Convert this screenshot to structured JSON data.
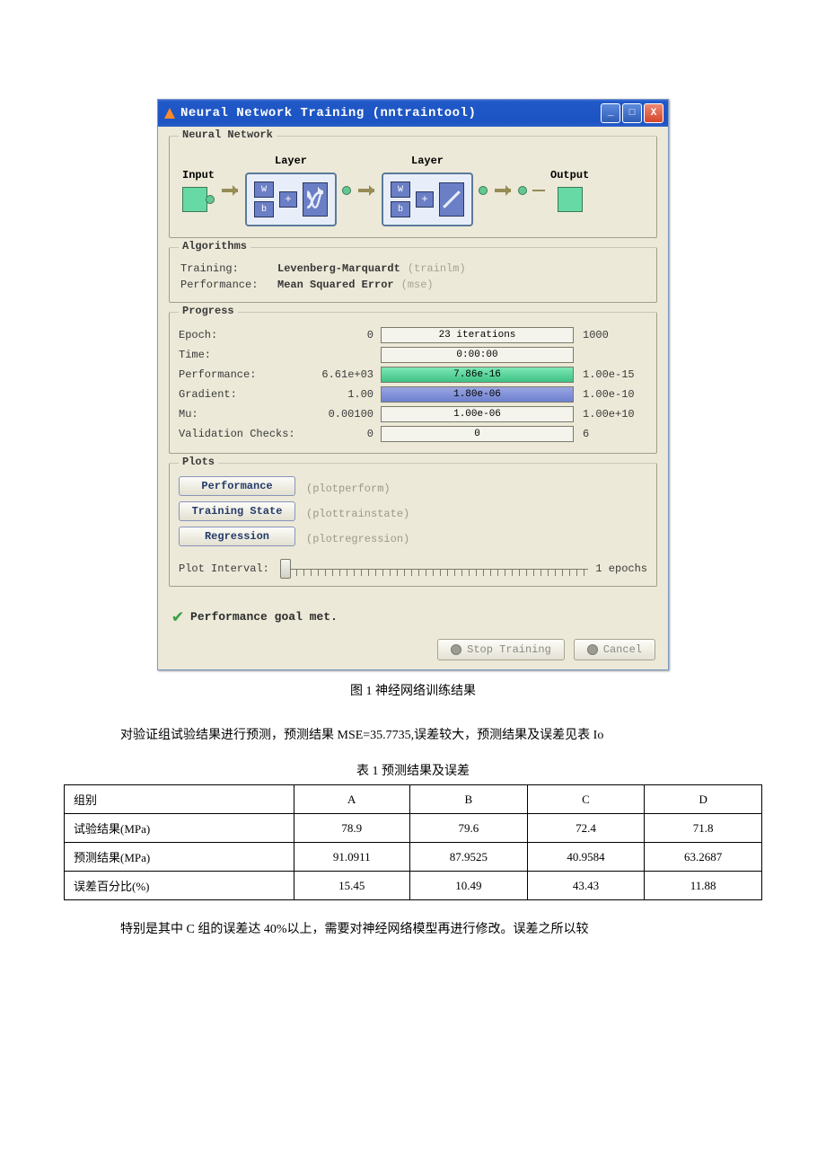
{
  "window": {
    "title": "Neural Network Training (nntraintool)",
    "icons": {
      "min": "_",
      "max": "□",
      "close": "X"
    }
  },
  "groups": {
    "network": "Neural Network",
    "algorithms": "Algorithms",
    "progress": "Progress",
    "plots": "Plots"
  },
  "diagram": {
    "input": "Input",
    "layer": "Layer",
    "output": "Output",
    "w": "W",
    "b": "b"
  },
  "algorithms": {
    "training_label": "Training:",
    "training_value": "Levenberg-Marquardt",
    "training_fn": "(trainlm)",
    "perf_label": "Performance:",
    "perf_value": "Mean Squared Error",
    "perf_fn": "(mse)"
  },
  "progress": {
    "rows": [
      {
        "label": "Epoch:",
        "start": "0",
        "text": "23 iterations",
        "end": "1000",
        "fill": "none",
        "pct": 5
      },
      {
        "label": "Time:",
        "start": "",
        "text": "0:00:00",
        "end": "",
        "fill": "none",
        "pct": 0
      },
      {
        "label": "Performance:",
        "start": "6.61e+03",
        "text": "7.86e-16",
        "end": "1.00e-15",
        "fill": "green",
        "pct": 100
      },
      {
        "label": "Gradient:",
        "start": "1.00",
        "text": "1.80e-06",
        "end": "1.00e-10",
        "fill": "blue",
        "pct": 100
      },
      {
        "label": "Mu:",
        "start": "0.00100",
        "text": "1.00e-06",
        "end": "1.00e+10",
        "fill": "none",
        "pct": 0
      },
      {
        "label": "Validation Checks:",
        "start": "0",
        "text": "0",
        "end": "6",
        "fill": "none",
        "pct": 0
      }
    ]
  },
  "plots": {
    "buttons": [
      {
        "label": "Performance",
        "fn": "(plotperform)"
      },
      {
        "label": "Training State",
        "fn": "(plottrainstate)"
      },
      {
        "label": "Regression",
        "fn": "(plotregression)"
      }
    ],
    "interval_label": "Plot Interval:",
    "interval_value": "1 epochs"
  },
  "status": "Performance goal met.",
  "footer": {
    "stop": "Stop Training",
    "cancel": "Cancel"
  },
  "doc": {
    "fig_caption": "图 1 神经网络训练结果",
    "para1": "对验证组试验结果进行预测，预测结果 MSE=35.7735,误差较大，预测结果及误差见表 Io",
    "tbl_caption": "表 1 预测结果及误差",
    "table": {
      "headers": [
        "组别",
        "A",
        "B",
        "C",
        "D"
      ],
      "rows": [
        [
          "试验结果(MPa)",
          "78.9",
          "79.6",
          "72.4",
          "71.8"
        ],
        [
          "预测结果(MPa)",
          "91.0911",
          "87.9525",
          "40.9584",
          "63.2687"
        ],
        [
          "误差百分比(%)",
          "15.45",
          "10.49",
          "43.43",
          "11.88"
        ]
      ]
    },
    "para2": "特别是其中 C 组的误差达 40%以上，需要对神经网络模型再进行修改。误差之所以较"
  },
  "chart_data": {
    "type": "table",
    "title": "表 1 预测结果及误差",
    "categories": [
      "A",
      "B",
      "C",
      "D"
    ],
    "series": [
      {
        "name": "试验结果(MPa)",
        "values": [
          78.9,
          79.6,
          72.4,
          71.8
        ]
      },
      {
        "name": "预测结果(MPa)",
        "values": [
          91.0911,
          87.9525,
          40.9584,
          63.2687
        ]
      },
      {
        "name": "误差百分比(%)",
        "values": [
          15.45,
          10.49,
          43.43,
          11.88
        ]
      }
    ]
  }
}
